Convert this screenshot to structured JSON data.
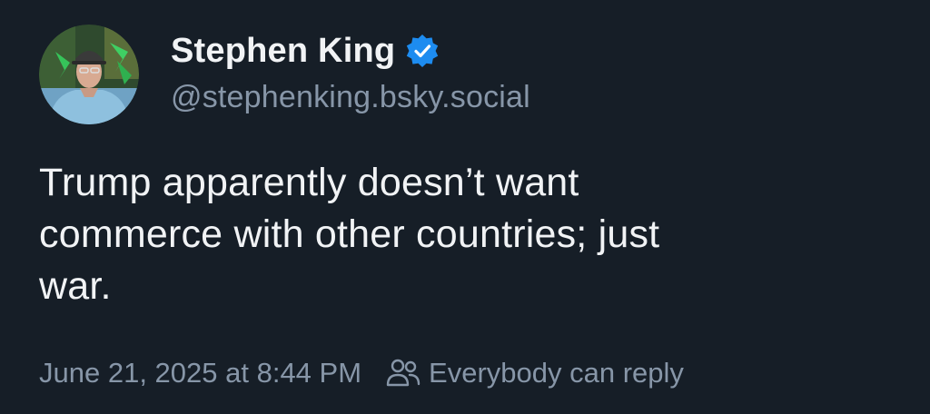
{
  "post": {
    "author": {
      "display_name": "Stephen King",
      "handle": "@stephenking.bsky.social",
      "verified": true,
      "verified_badge_color": "#1d8cf0"
    },
    "text_lines": [
      "Trump apparently doesn’t want",
      "commerce with other countries; just",
      "war."
    ],
    "timestamp": "June 21, 2025 at 8:44 PM",
    "reply_setting": {
      "icon": "people-icon",
      "label": "Everybody can reply"
    }
  },
  "colors": {
    "background": "#161e27",
    "primary_text": "#f1f3f5",
    "secondary_text": "#8796a8",
    "accent": "#1d8cf0"
  }
}
